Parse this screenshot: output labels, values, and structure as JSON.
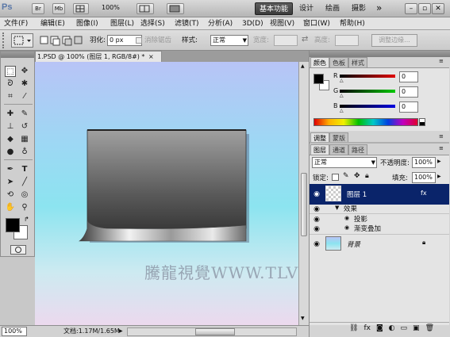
{
  "titlebar": {
    "logo": "Ps",
    "btn_br": "Br",
    "btn_mb": "Mb",
    "zoom": "100%",
    "workspaces": [
      "基本功能",
      "设计",
      "绘画",
      "摄影"
    ],
    "more": "»"
  },
  "menu": [
    "文件(F)",
    "编辑(E)",
    "图像(I)",
    "图层(L)",
    "选择(S)",
    "滤镜(T)",
    "分析(A)",
    "3D(D)",
    "视图(V)",
    "窗口(W)",
    "帮助(H)"
  ],
  "options": {
    "feather_label": "羽化:",
    "feather_value": "0 px",
    "antialias_label": "消除锯齿",
    "style_label": "样式:",
    "style_value": "正常",
    "width_label": "宽度:",
    "height_label": "高度:",
    "refine_edge": "调整边缘..."
  },
  "document": {
    "tab_title": "1.PSD @ 100% (图层 1, RGB/8#) *",
    "tab_close": "×"
  },
  "status": {
    "zoom": "100%",
    "doc_info": "文档:1.17M/1.65M"
  },
  "color_panel": {
    "tabs": [
      "颜色",
      "色板",
      "样式"
    ],
    "channels": [
      {
        "label": "R",
        "value": "0"
      },
      {
        "label": "G",
        "value": "0"
      },
      {
        "label": "B",
        "value": "0"
      }
    ]
  },
  "adjust_panel": {
    "tabs": [
      "调整",
      "蒙版"
    ]
  },
  "layers_panel": {
    "tabs": [
      "图层",
      "通道",
      "路径"
    ],
    "blend_mode": "正常",
    "opacity_label": "不透明度:",
    "opacity_value": "100%",
    "lock_label": "锁定:",
    "fill_label": "填充:",
    "fill_value": "100%",
    "layers": [
      {
        "name": "图层 1",
        "selected": true
      },
      {
        "name": "背景",
        "selected": false
      }
    ],
    "effects_label": "效果",
    "effects": [
      "投影",
      "渐变叠加"
    ]
  },
  "watermark": "騰龍視覺WWW.TLVI.NET",
  "colors": {
    "selected_layer": "#0a246a",
    "canvas_top": "#b8c4f6",
    "canvas_mid": "#8ce4f0"
  }
}
